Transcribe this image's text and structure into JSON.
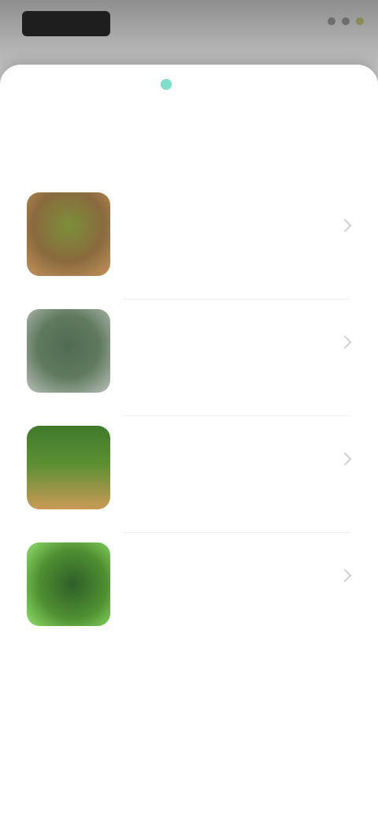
{
  "status_bar": {
    "icons": [
      "signal-icon",
      "wifi-icon",
      "battery-icon"
    ]
  },
  "sheet": {
    "title": "",
    "items": [
      {
        "name": "",
        "subtitle": "",
        "thumb": "plant-thumbnail-1"
      },
      {
        "name": "",
        "subtitle": "",
        "thumb": "plant-thumbnail-2"
      },
      {
        "name": "",
        "subtitle": "",
        "thumb": "plant-thumbnail-3"
      },
      {
        "name": "",
        "subtitle": "",
        "thumb": "plant-thumbnail-4"
      }
    ]
  },
  "colors": {
    "accent": "#17c49b",
    "sheet_background": "#ffffff",
    "scrim": "#9a9a9a"
  }
}
